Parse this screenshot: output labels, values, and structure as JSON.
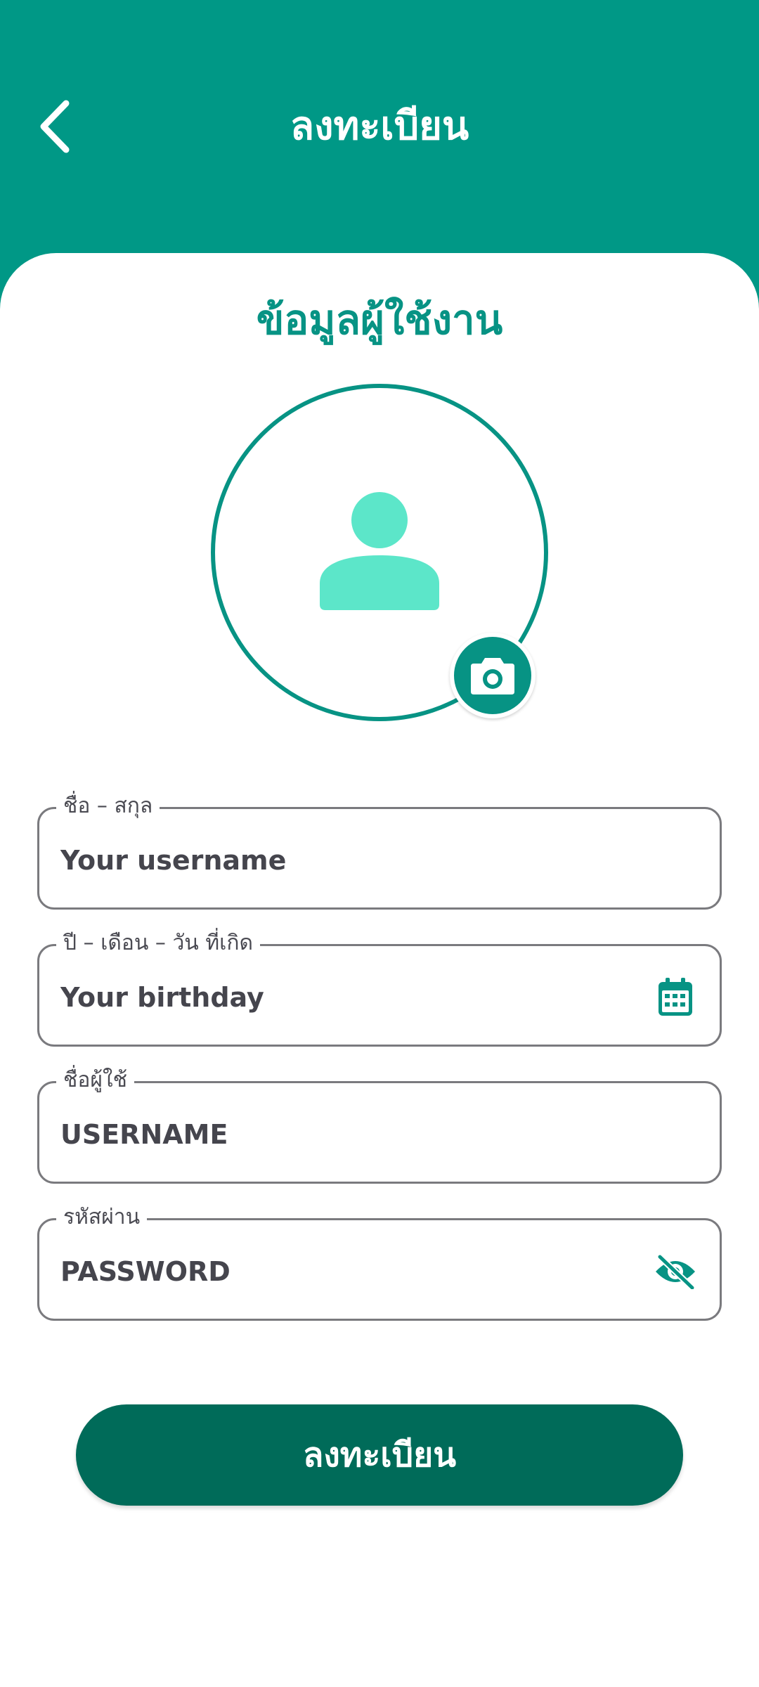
{
  "header": {
    "title": "ลงทะเบียน",
    "back_icon": "chevron-left-icon"
  },
  "section": {
    "title": "ข้อมูลผู้ใช้งาน"
  },
  "avatar": {
    "placeholder_icon": "person-icon",
    "upload_icon": "camera-icon"
  },
  "fields": [
    {
      "label": "ชื่อ – สกุล",
      "placeholder": "Your username"
    },
    {
      "label": "ปี – เดือน – วัน ที่เกิด",
      "placeholder": "Your birthday",
      "icon": "calendar-icon"
    },
    {
      "label": "ชื่อผู้ใช้",
      "placeholder": "USERNAME"
    },
    {
      "label": "รหัสผ่าน",
      "placeholder": "PASSWORD",
      "icon": "eye-off-icon"
    }
  ],
  "submit": {
    "label": "ลงทะเบียน"
  },
  "colors": {
    "primary": "#009886",
    "accent": "#079384",
    "button": "#006b59",
    "avatar_fill": "#5ce6c9"
  }
}
